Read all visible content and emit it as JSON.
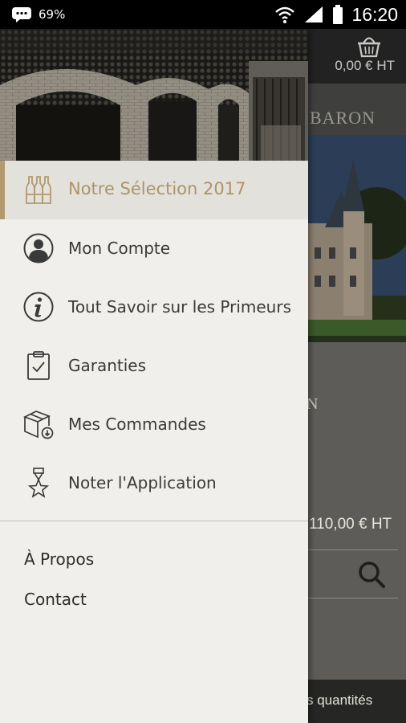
{
  "status_bar": {
    "battery_percent": "69%",
    "time": "16:20",
    "icons": [
      "message-icon",
      "wifi-icon",
      "signal-icon",
      "battery-icon"
    ]
  },
  "background_app": {
    "cart_price": "0,00 € HT",
    "brand_partial": "BARON",
    "partial_heading": "N",
    "product_price": "110,00 € HT",
    "bottom_partial": "s quantités"
  },
  "drawer": {
    "menu": [
      {
        "label": "Notre Sélection 2017",
        "icon": "wine-bottles-icon",
        "active": true
      },
      {
        "label": "Mon Compte",
        "icon": "account-icon",
        "active": false
      },
      {
        "label": "Tout Savoir sur les Primeurs",
        "icon": "info-icon",
        "active": false
      },
      {
        "label": "Garanties",
        "icon": "clipboard-check-icon",
        "active": false
      },
      {
        "label": "Mes Commandes",
        "icon": "package-icon",
        "active": false
      },
      {
        "label": "Noter l'Application",
        "icon": "medal-star-icon",
        "active": false
      }
    ],
    "secondary": [
      {
        "label": "À Propos"
      },
      {
        "label": "Contact"
      }
    ]
  },
  "colors": {
    "accent_gold": "#ad9466",
    "drawer_bg": "#f0efeb",
    "active_bg": "#e2e1dc"
  }
}
